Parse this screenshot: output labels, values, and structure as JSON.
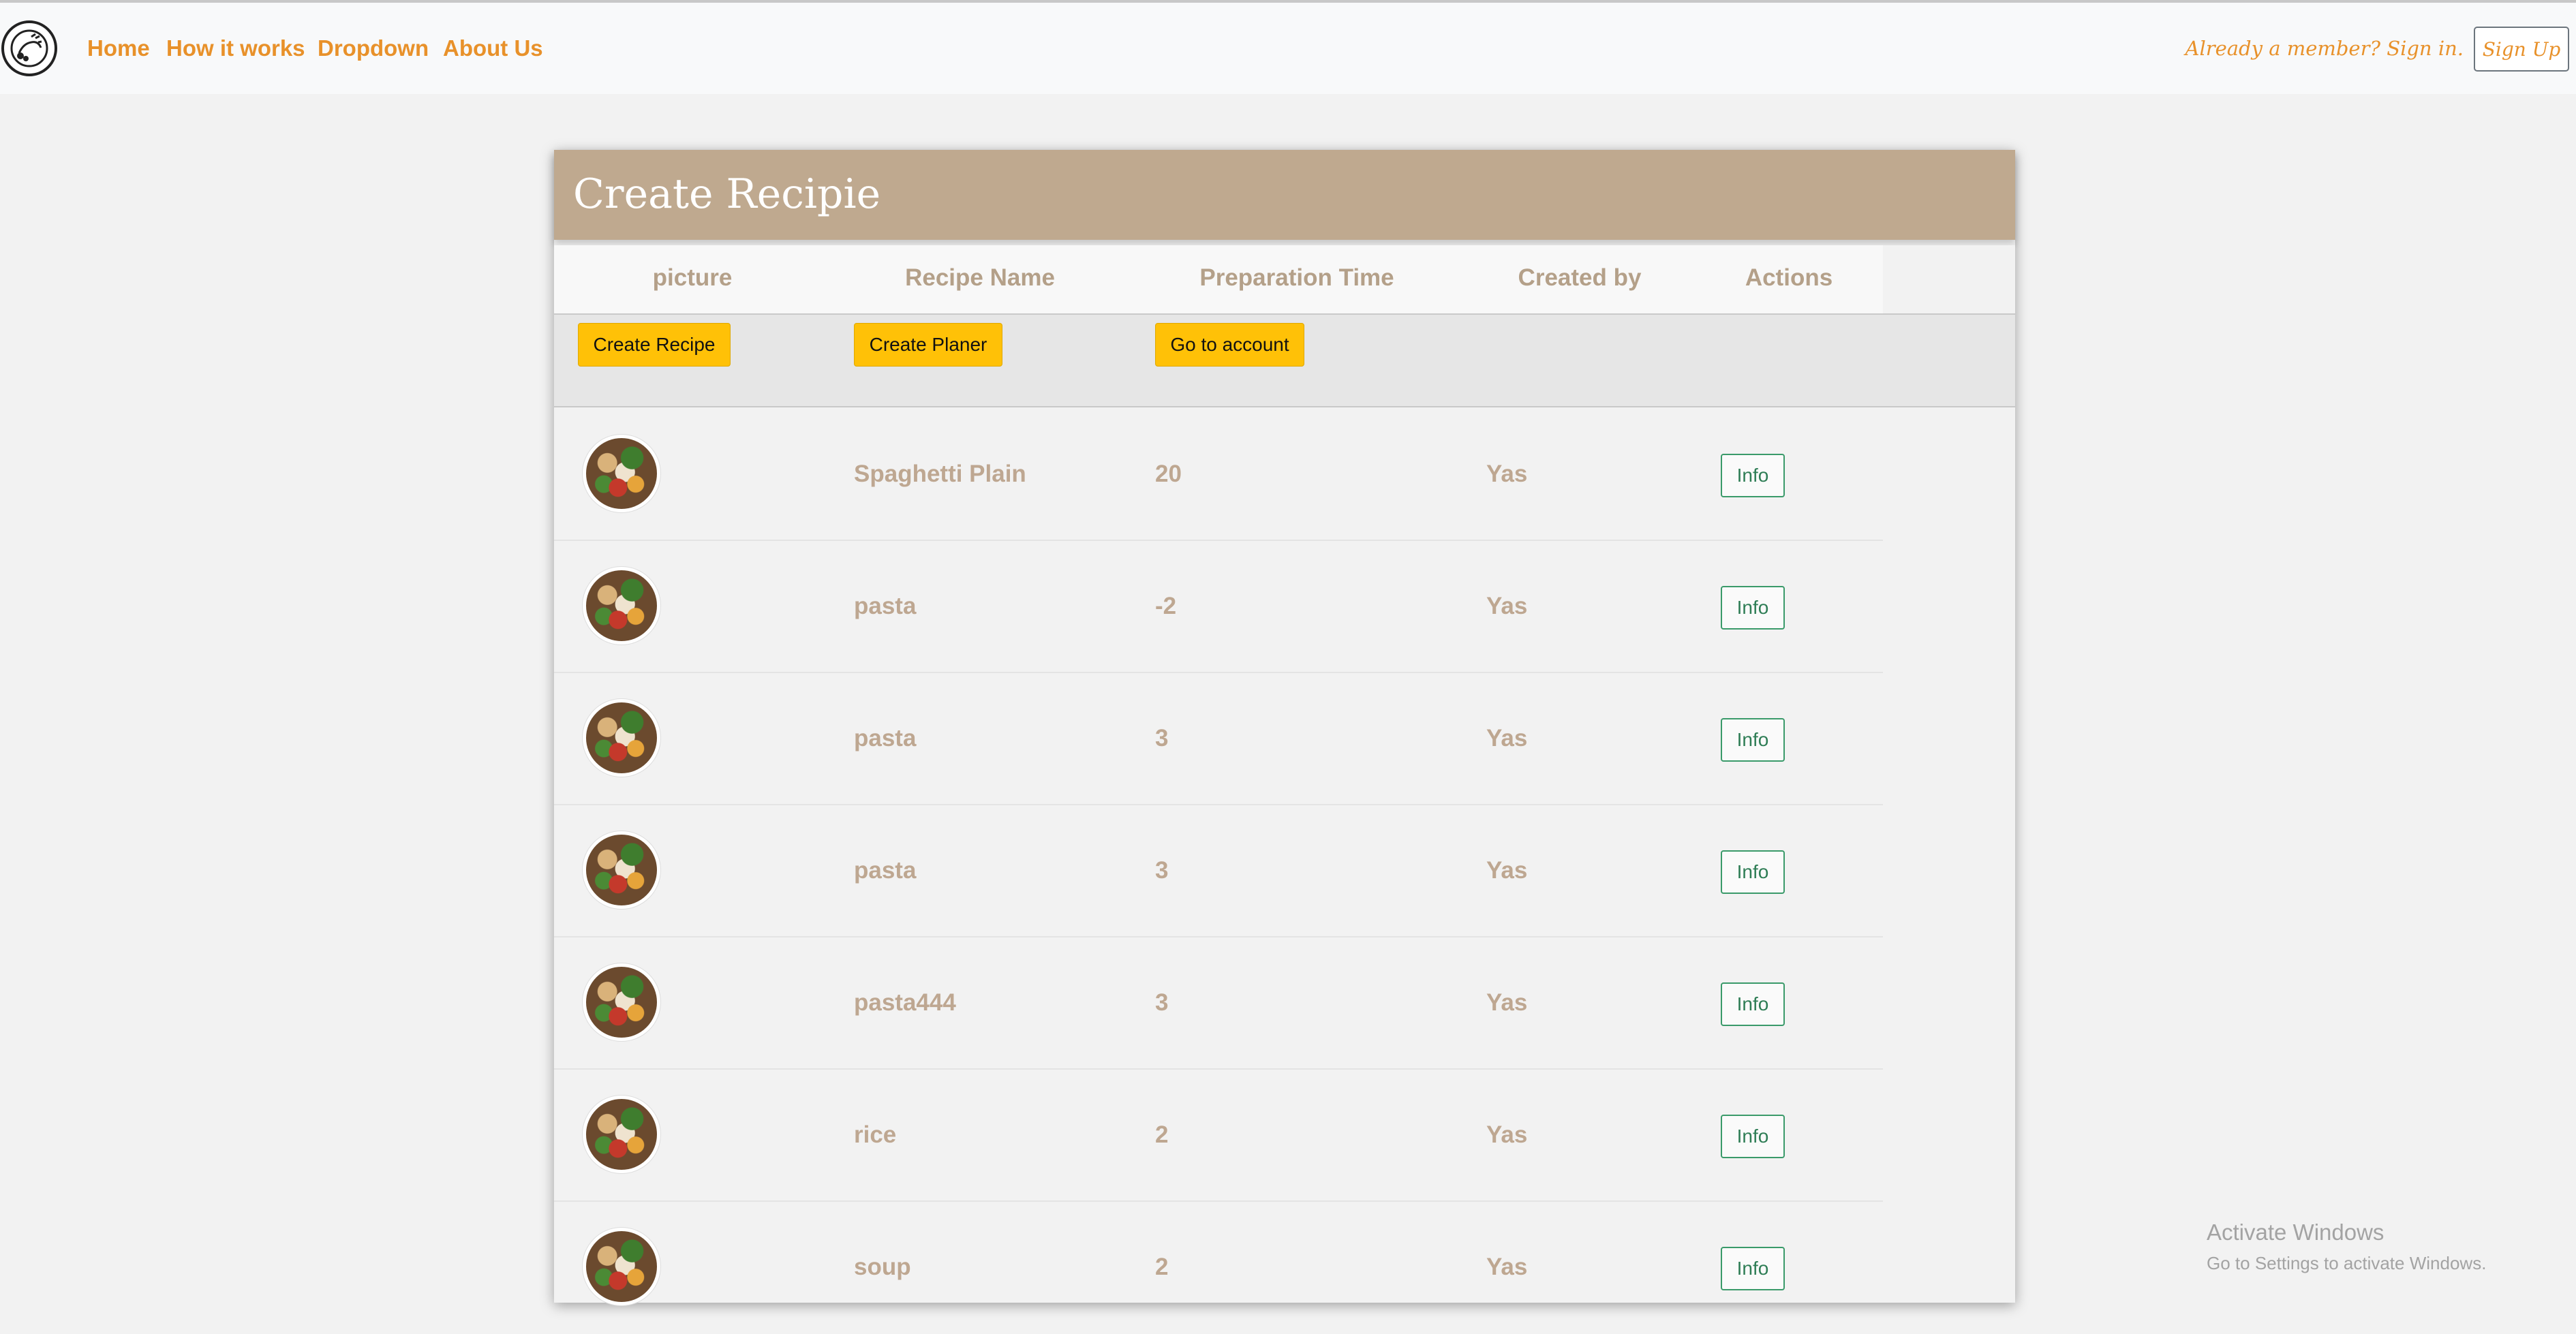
{
  "nav": {
    "links": [
      "Home",
      "How it works",
      "Dropdown",
      "About Us"
    ],
    "member_text": "Already a member? Sign in.",
    "signup_label": "Sign Up"
  },
  "card": {
    "title": "Create Recipie",
    "columns": [
      "picture",
      "Recipe Name",
      "Preparation Time",
      "Created by",
      "Actions"
    ],
    "action_buttons": [
      "Create Recipe",
      "Create Planer",
      "Go to account"
    ],
    "rows": [
      {
        "name": "Spaghetti Plain",
        "time": "20",
        "created_by": "Yas",
        "action": "Info"
      },
      {
        "name": "pasta",
        "time": "-2",
        "created_by": "Yas",
        "action": "Info"
      },
      {
        "name": "pasta",
        "time": "3",
        "created_by": "Yas",
        "action": "Info"
      },
      {
        "name": "pasta",
        "time": "3",
        "created_by": "Yas",
        "action": "Info"
      },
      {
        "name": "pasta444",
        "time": "3",
        "created_by": "Yas",
        "action": "Info"
      },
      {
        "name": "rice",
        "time": "2",
        "created_by": "Yas",
        "action": "Info"
      },
      {
        "name": "soup",
        "time": "2",
        "created_by": "Yas",
        "action": "Info"
      }
    ]
  },
  "watermark": {
    "title": "Activate Windows",
    "subtitle": "Go to Settings to activate Windows."
  },
  "colors": {
    "nav_link": "#e8912a",
    "header": "#bfa98f",
    "cell_text": "#bea791",
    "action_button": "#ffc107",
    "info_border": "#3a9a6a"
  },
  "icons": {
    "logo": "recipe-logo-icon"
  }
}
